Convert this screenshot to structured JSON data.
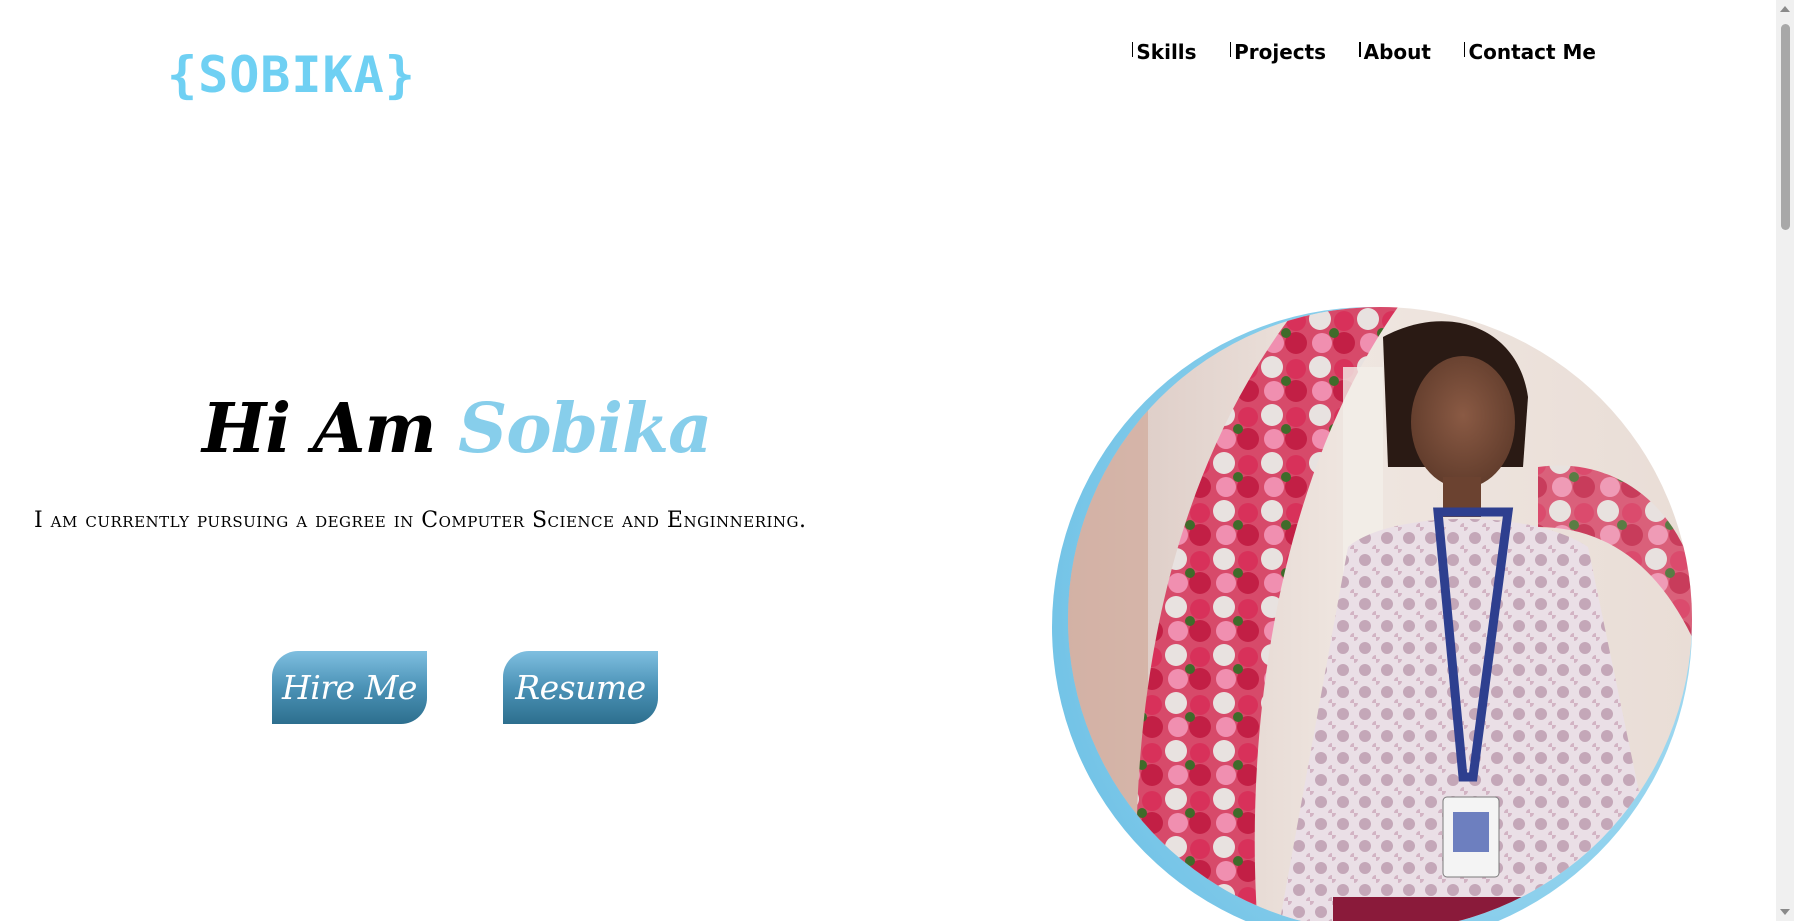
{
  "header": {
    "logo": "{SOBIKA}",
    "nav": [
      {
        "label": "Skills"
      },
      {
        "label": "Projects"
      },
      {
        "label": "About"
      },
      {
        "label": "Contact Me"
      }
    ]
  },
  "hero": {
    "greeting": "Hi Am ",
    "name": "Sobika",
    "subtitle": "I am currently pursuing a degree in Computer Science and Enginnering.",
    "buttons": {
      "hire": "Hire Me",
      "resume": "Resume"
    }
  },
  "colors": {
    "accent": "#87ceeb",
    "logo": "#6fd0f3",
    "button_top": "#7fbfe0",
    "button_bottom": "#2d6f8e"
  },
  "icons": {
    "scroll_up": "triangle-up-icon",
    "scroll_down": "triangle-down-icon"
  }
}
